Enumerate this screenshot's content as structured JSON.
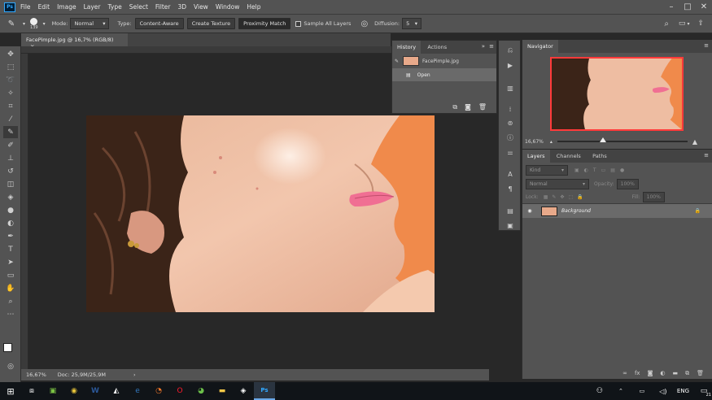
{
  "menubar": {
    "app_icon": "Ps",
    "items": [
      "File",
      "Edit",
      "Image",
      "Layer",
      "Type",
      "Select",
      "Filter",
      "3D",
      "View",
      "Window",
      "Help"
    ]
  },
  "options": {
    "brush_size": "139",
    "mode_label": "Mode:",
    "mode_value": "Normal",
    "type_label": "Type:",
    "type_buttons": [
      "Content-Aware",
      "Create Texture",
      "Proximity Match"
    ],
    "sample_all_layers": "Sample All Layers",
    "diffusion_label": "Diffusion:",
    "diffusion_value": "5"
  },
  "document": {
    "tab_title": "FacePimple.jpg @ 16,7% (RGB/8)",
    "zoom": "16,67%",
    "doc_size": "Doc: 25,9M/25,9M"
  },
  "history": {
    "tabs": [
      "History",
      "Actions"
    ],
    "snapshot": "FacePimple.jpg",
    "states": [
      "Open"
    ]
  },
  "navigator": {
    "title": "Navigator",
    "zoom": "16,67%",
    "zoom_fraction": 0.35
  },
  "layers": {
    "tabs": [
      "Layers",
      "Channels",
      "Paths"
    ],
    "filter_kind": "Kind",
    "blend_mode": "Normal",
    "opacity_label": "Opacity:",
    "opacity_value": "100%",
    "lock_label": "Lock:",
    "fill_label": "Fill:",
    "fill_value": "100%",
    "layer_name": "Background"
  },
  "taskbar": {
    "lang": "ENG",
    "notif_count": "21"
  },
  "colors": {
    "accent": "#31a8ff",
    "panel": "#535353",
    "canvas_bg": "#282828",
    "orange_bg": "#f08a4b"
  }
}
